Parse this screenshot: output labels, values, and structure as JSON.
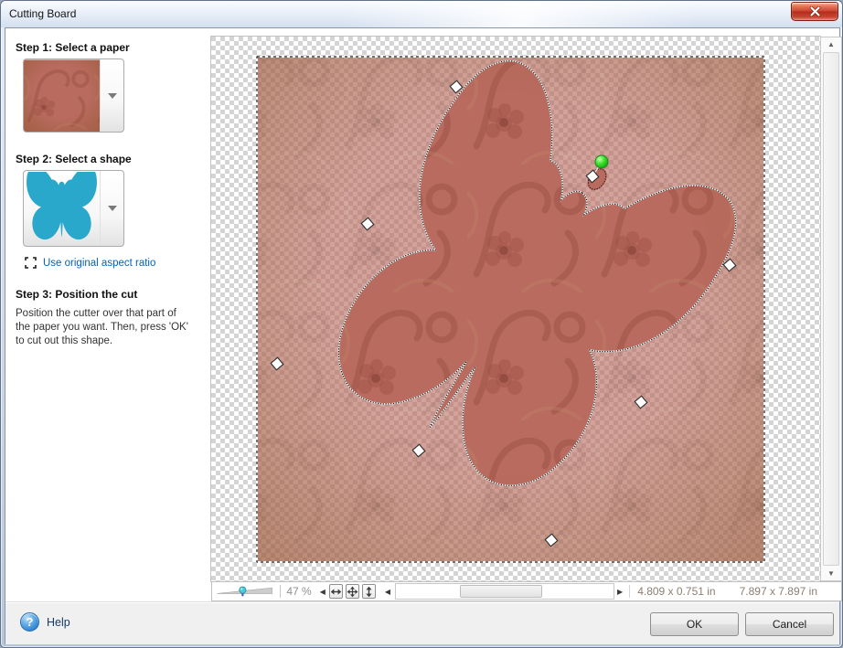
{
  "window": {
    "title": "Cutting Board"
  },
  "left_panel": {
    "step1_heading": "Step 1: Select a paper",
    "step2_heading": "Step 2: Select a shape",
    "aspect_ratio_link": "Use original aspect ratio",
    "step3_heading": "Step 3: Position the cut",
    "step3_body": "Position the cutter over that part of the paper you want.  Then, press 'OK' to cut out this shape."
  },
  "toolbar": {
    "zoom_percent": "47 %",
    "cut_dimensions": "4.809 x 0.751 in",
    "paper_dimensions": "7.897 x 7.897 in"
  },
  "footer": {
    "help_label": "Help",
    "ok_label": "OK",
    "cancel_label": "Cancel"
  },
  "icons": {
    "help_glyph": "?",
    "scroll_left": "◀",
    "scroll_right": "▶",
    "scroll_up": "▲",
    "scroll_down": "▼"
  },
  "colors": {
    "shape_teal": "#29a8cb",
    "paper_base": "#b86b5e",
    "paper_motif": "#9a4e41",
    "link_blue": "#0063b8",
    "help_navy": "#173a66",
    "rotation_handle_green": "#3fe32f"
  }
}
